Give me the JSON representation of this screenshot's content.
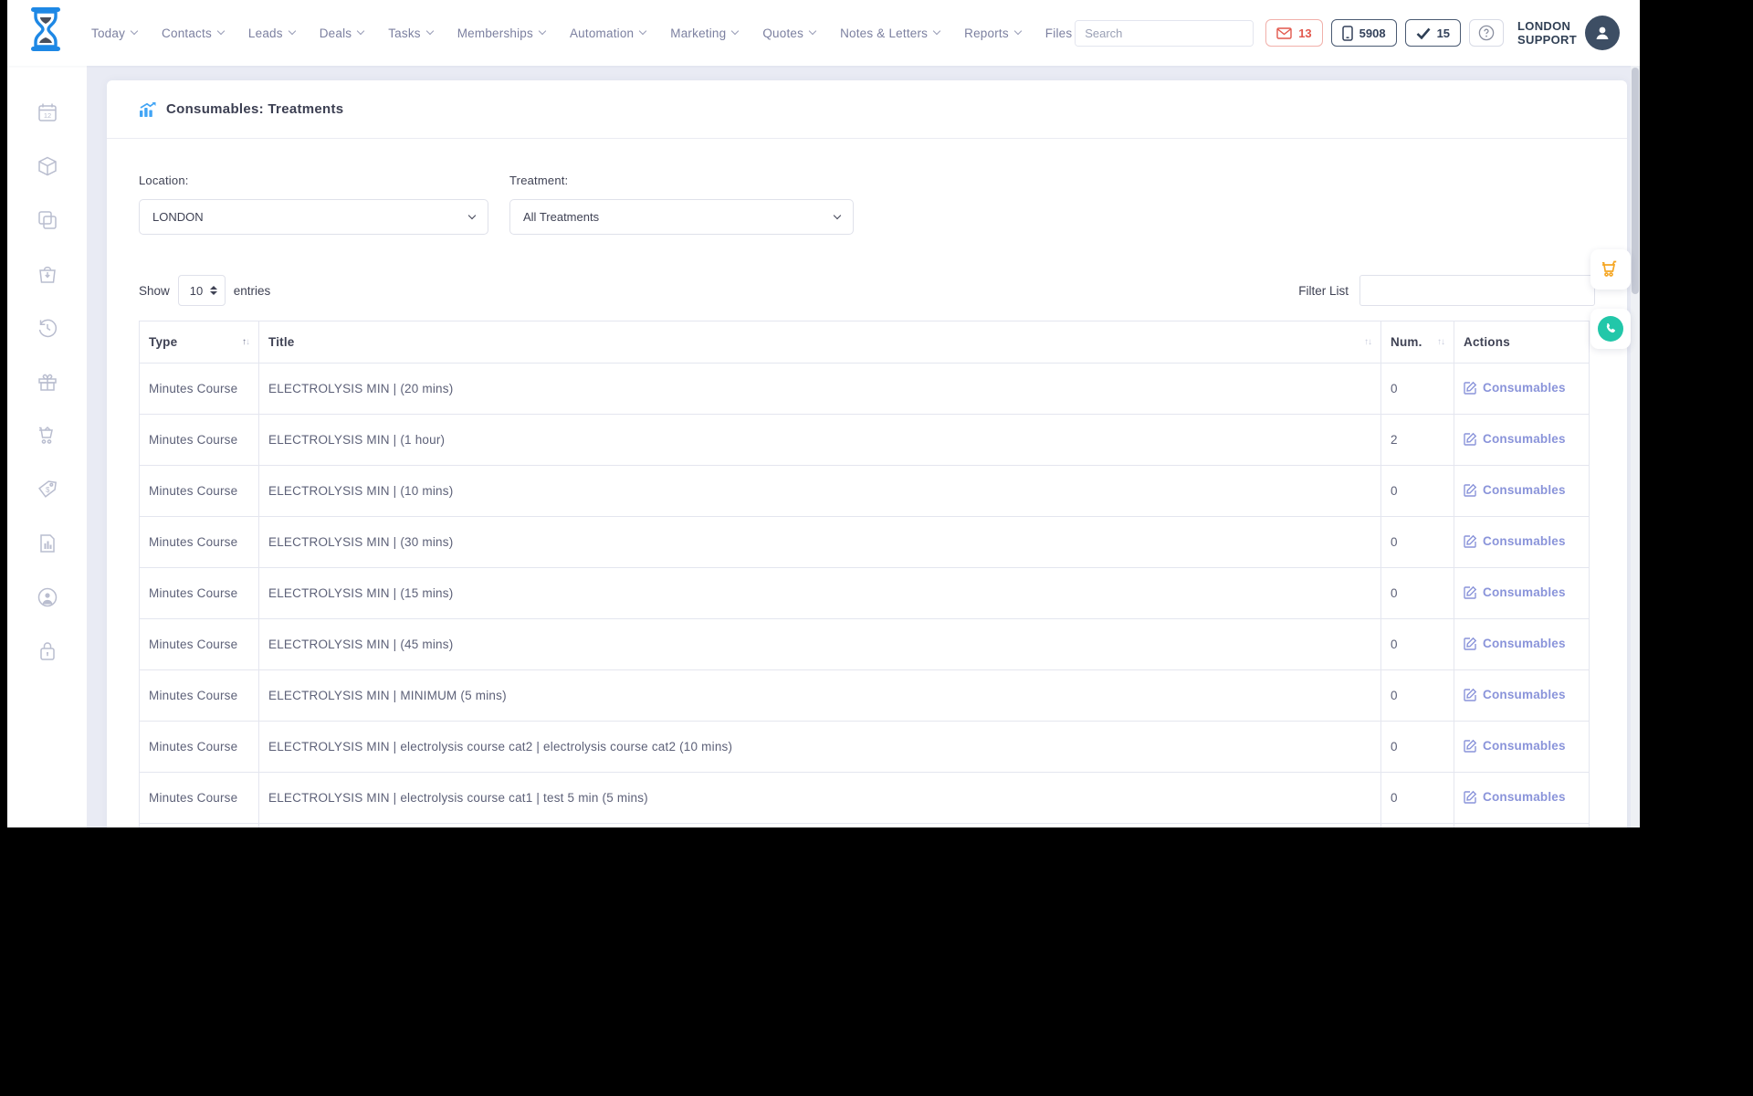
{
  "topbar": {
    "nav": [
      {
        "label": "Today",
        "chevron": true
      },
      {
        "label": "Contacts",
        "chevron": true
      },
      {
        "label": "Leads",
        "chevron": true
      },
      {
        "label": "Deals",
        "chevron": true
      },
      {
        "label": "Tasks",
        "chevron": true
      },
      {
        "label": "Memberships",
        "chevron": true
      },
      {
        "label": "Automation",
        "chevron": true
      },
      {
        "label": "Marketing",
        "chevron": true
      },
      {
        "label": "Quotes",
        "chevron": true
      },
      {
        "label": "Notes & Letters",
        "chevron": true
      },
      {
        "label": "Reports",
        "chevron": true
      },
      {
        "label": "Files",
        "chevron": false
      }
    ],
    "search": {
      "placeholder": "Search",
      "value": ""
    },
    "badges": {
      "mail_count": "13",
      "phone_count": "5908",
      "check_count": "15"
    },
    "user": {
      "line1": "LONDON",
      "line2": "SUPPORT"
    }
  },
  "sidebar": {
    "icons": [
      "calendar-icon",
      "package-icon",
      "copy-icon",
      "bag-download-icon",
      "history-icon",
      "gift-icon",
      "cart-icon",
      "price-tag-icon",
      "report-icon",
      "account-icon",
      "lock-icon"
    ]
  },
  "page": {
    "title": "Consumables: Treatments",
    "filters": {
      "location_label": "Location:",
      "location_value": "LONDON",
      "treatment_label": "Treatment:",
      "treatment_value": "All Treatments"
    },
    "show_entries": {
      "prefix": "Show",
      "value": "10",
      "suffix": "entries"
    },
    "filter_list": {
      "label": "Filter List",
      "value": ""
    },
    "table": {
      "columns": [
        "Type",
        "Title",
        "Num.",
        "Actions"
      ],
      "action_label": "Consumables",
      "rows": [
        {
          "type": "Minutes Course",
          "title": "ELECTROLYSIS MIN | (20 mins)",
          "num": "0"
        },
        {
          "type": "Minutes Course",
          "title": "ELECTROLYSIS MIN | (1 hour)",
          "num": "2"
        },
        {
          "type": "Minutes Course",
          "title": "ELECTROLYSIS MIN | (10 mins)",
          "num": "0"
        },
        {
          "type": "Minutes Course",
          "title": "ELECTROLYSIS MIN | (30 mins)",
          "num": "0"
        },
        {
          "type": "Minutes Course",
          "title": "ELECTROLYSIS MIN | (15 mins)",
          "num": "0"
        },
        {
          "type": "Minutes Course",
          "title": "ELECTROLYSIS MIN | (45 mins)",
          "num": "0"
        },
        {
          "type": "Minutes Course",
          "title": "ELECTROLYSIS MIN | MINIMUM (5 mins)",
          "num": "0"
        },
        {
          "type": "Minutes Course",
          "title": "ELECTROLYSIS MIN | electrolysis course cat2 | electrolysis course cat2 (10 mins)",
          "num": "0"
        },
        {
          "type": "Minutes Course",
          "title": "ELECTROLYSIS MIN | electrolysis course cat1 | test 5 min (5 mins)",
          "num": "0"
        }
      ]
    }
  },
  "colors": {
    "brand_blue": "#1e88e5",
    "title_icon_blue": "#42a5f5",
    "alert_red": "#e2574c",
    "dark_navy": "#33415a",
    "link_periwinkle": "#8a94da",
    "cart_orange": "#f5a623",
    "whatsapp_teal": "#22c7a9",
    "content_background": "#e9ebf4"
  }
}
